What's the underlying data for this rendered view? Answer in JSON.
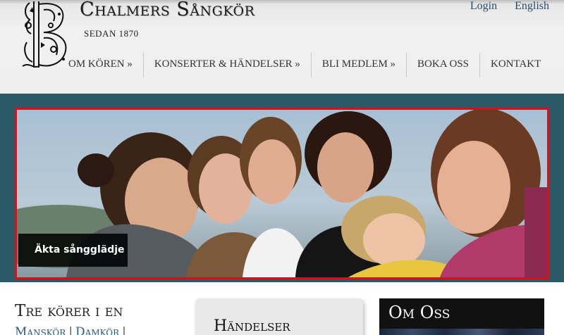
{
  "header": {
    "title": "Chalmers Sångkör",
    "subtitle": "SEDAN 1870",
    "top_links": [
      "Login",
      "English"
    ]
  },
  "nav": {
    "items": [
      "OM KÖREN »",
      "KONSERTER & HÄNDELSER »",
      "BLI MEDLEM »",
      "BOKA OSS",
      "KONTAKT"
    ]
  },
  "hero": {
    "caption": "Äkta sångglädje",
    "border_color": "#e20b14",
    "background_color": "#2a5a66"
  },
  "content": {
    "col1_title": "Tre körer i en",
    "col1_links": [
      "Manskör",
      "Damkör"
    ],
    "events_title": "Händelser",
    "about_title": "Om Oss"
  }
}
